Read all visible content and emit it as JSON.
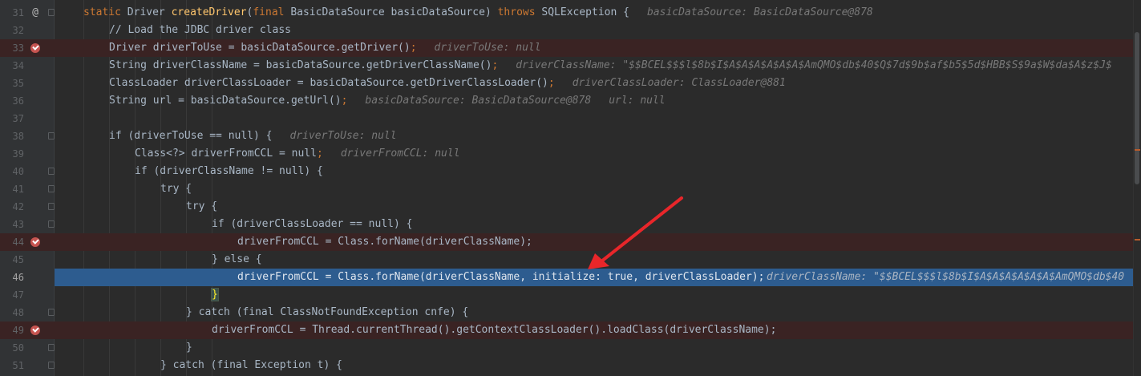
{
  "lines": [
    {
      "num": "31",
      "marker": "@",
      "marker_kind": "annotation",
      "code": [
        "static ",
        "Driver ",
        "createDriver",
        "(",
        "final ",
        "BasicDataSource basicDataSource) ",
        "throws ",
        "SQLException {"
      ],
      "hint": "basicDataSource: BasicDataSource@878"
    },
    {
      "num": "32",
      "comment": "// Load the JDBC driver class"
    },
    {
      "num": "33",
      "breakpoint": true,
      "code_text": "Driver driverToUse = basicDataSource.getDriver()",
      "hint": "driverToUse: null"
    },
    {
      "num": "34",
      "code_text": "String driverClassName = basicDataSource.getDriverClassName()",
      "hint": "driverClassName: \"$$BCEL$$$l$8b$I$A$A$A$A$A$A$AmQMO$db$40$Q$7d$9b$af$b5$5d$HBB$S$9a$W$da$A$z$J$"
    },
    {
      "num": "35",
      "code_text": "ClassLoader driverClassLoader = basicDataSource.getDriverClassLoader()",
      "hint": "driverClassLoader: ClassLoader@881"
    },
    {
      "num": "36",
      "code_text": "String url = basicDataSource.getUrl()",
      "hint": "basicDataSource: BasicDataSource@878",
      "hint_b": "url: null"
    },
    {
      "num": "37"
    },
    {
      "num": "38",
      "code_text": "if (driverToUse == null) {",
      "hint": "driverToUse: null"
    },
    {
      "num": "39",
      "code_text": "Class<?> driverFromCCL = null",
      "hint": "driverFromCCL: null"
    },
    {
      "num": "40",
      "code_text": "if (driverClassName != null) {"
    },
    {
      "num": "41",
      "code_text": "try {"
    },
    {
      "num": "42",
      "code_text": "try {"
    },
    {
      "num": "43",
      "code_text": "if (driverClassLoader == null) {"
    },
    {
      "num": "44",
      "breakpoint": true,
      "code_text": "driverFromCCL = Class.forName(driverClassName);"
    },
    {
      "num": "45",
      "code_text": "} else {"
    },
    {
      "num": "46",
      "current": true,
      "code_text": "driverFromCCL = Class.forName(driverClassName, initialize: true, driverClassLoader);",
      "inlay": "initialize:",
      "hint": "driverClassName: \"$$BCEL$$$l$8b$I$A$A$A$A$A$A$AmQMO$db$40"
    },
    {
      "num": "47",
      "code_text": "}"
    },
    {
      "num": "48",
      "code_text": "} catch (final ClassNotFoundException cnfe) {"
    },
    {
      "num": "49",
      "breakpoint": true,
      "code_text": "driverFromCCL = Thread.currentThread().getContextClassLoader().loadClass(driverClassName);"
    },
    {
      "num": "50",
      "code_text": "}"
    },
    {
      "num": "51",
      "code_text": "} catch (final Exception t) {"
    }
  ],
  "colors": {
    "background": "#2b2b2b",
    "gutter": "#313335",
    "keyword": "#cc7832",
    "method": "#ffc66d",
    "current_line": "#2d5c8f",
    "breakpoint_line": "#3a2323",
    "breakpoint": "#c75450",
    "arrow": "#e8262a"
  },
  "icons": {
    "annotation": "at-sign-icon",
    "breakpoint": "breakpoint-icon",
    "fold": "fold-icon"
  }
}
